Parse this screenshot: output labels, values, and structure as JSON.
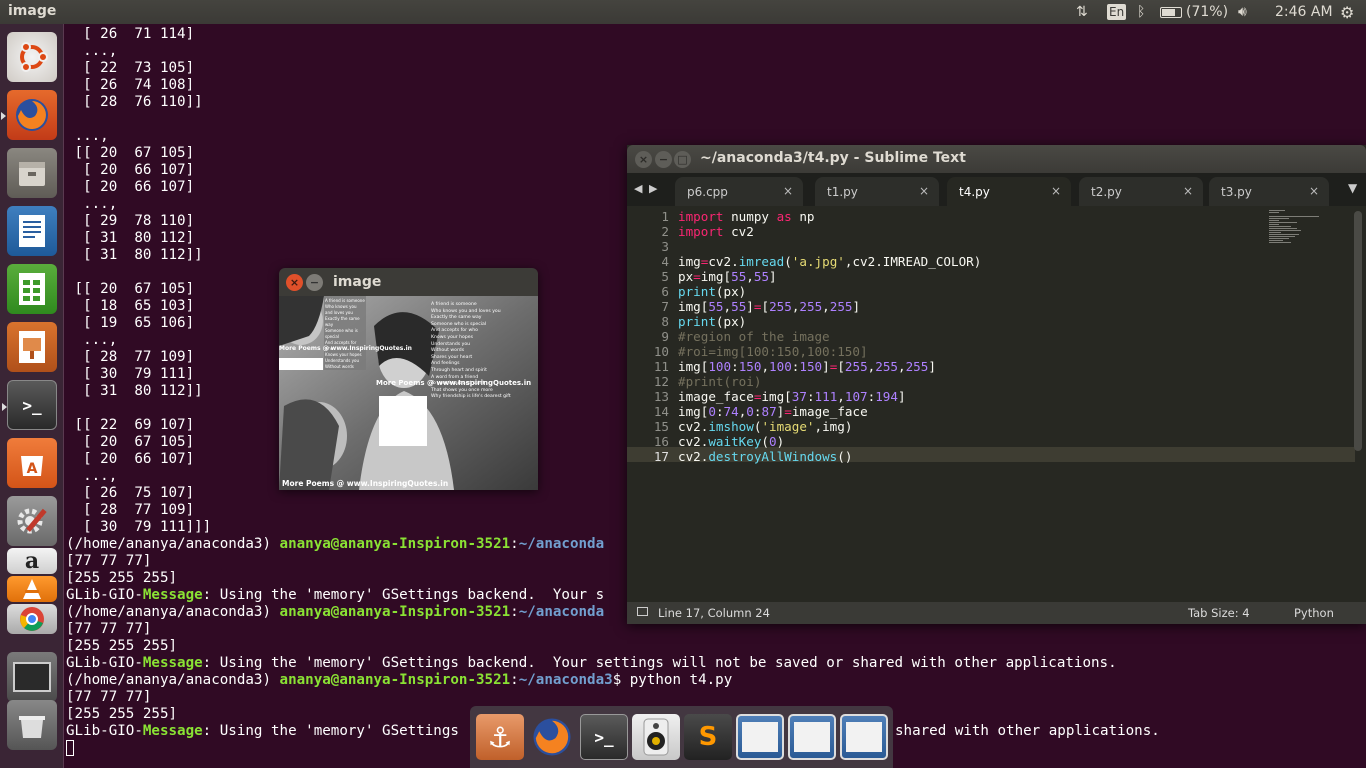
{
  "topbar": {
    "app_title": "image",
    "keyboard_layout": "En",
    "battery": "(71%)",
    "clock": "2:46 AM"
  },
  "launcher": {
    "items": [
      "dash-home",
      "firefox",
      "files",
      "writer",
      "calc",
      "impress",
      "terminal",
      "software-center",
      "system-settings",
      "amazon",
      "vlc",
      "chrome",
      "workspaces",
      "trash"
    ]
  },
  "terminal": {
    "lines": [
      "  [ 26  71 114]",
      "  ...,",
      "  [ 22  73 105]",
      "  [ 26  74 108]",
      "  [ 28  76 110]]",
      "",
      " ...,",
      " [[ 20  67 105]",
      "  [ 20  66 107]",
      "  [ 20  66 107]",
      "  ...,",
      "  [ 29  78 110]",
      "  [ 31  80 112]",
      "  [ 31  80 112]]",
      "",
      " [[ 20  67 105]",
      "  [ 18  65 103]",
      "  [ 19  65 106]",
      "  ...,",
      "  [ 28  77 109]",
      "  [ 30  79 111]",
      "  [ 31  80 112]]",
      "",
      " [[ 22  69 107]",
      "  [ 20  67 105]",
      "  [ 20  66 107]",
      "  ...,",
      "  [ 26  75 107]",
      "  [ 28  77 109]",
      "  [ 30  79 111]]]"
    ],
    "prompt_env": "(/home/ananya/anaconda3) ",
    "prompt_user": "ananya@ananya-Inspiron-3521",
    "prompt_colon": ":",
    "prompt_path_partial": "~/anaconda",
    "prompt_path": "~/anaconda3",
    "prompt_cmd": "$ python t4.py",
    "out1": "[77 77 77]",
    "out2": "[255 255 255]",
    "glib_prefix": "GLib-GIO-",
    "glib_msg": "Message",
    "glib_rest_partial": ": Using the 'memory' GSettings backend.  Your s",
    "glib_rest_full": ": Using the 'memory' GSettings backend.  Your settings will not be saved or shared with other applications.",
    "glib_rest_tail_a": ": Using the 'memory' GSettings",
    "glib_rest_tail_b": "shared with other applications."
  },
  "image_window": {
    "title": "image",
    "photo_captions": [
      "More Poems @ www.InspiringQuotes.in",
      "More Poems @ www.InspiringQuotes.in",
      "More Poems @ www.InspiringQuotes.in"
    ],
    "poem_lines": [
      "A friend is someone",
      "Who knows you and loves you",
      "Exactly the same way",
      "Someone who is special",
      "And accepts for who",
      "Knows your hopes",
      "Understands you",
      "Without words",
      "Shares your heart",
      "And feelings",
      "Through heart and spirit",
      "A word from a friend",
      "To your heart and spirit",
      "That shows you once more",
      "Why friendship is life's dearest gift"
    ]
  },
  "sublime": {
    "title": "~/anaconda3/t4.py - Sublime Text",
    "tabs": [
      {
        "label": "p6.cpp"
      },
      {
        "label": "t1.py"
      },
      {
        "label": "t4.py"
      },
      {
        "label": "t2.py"
      },
      {
        "label": "t3.py"
      }
    ],
    "tab_close": "×",
    "line_numbers": [
      "1",
      "2",
      "3",
      "4",
      "5",
      "6",
      "7",
      "8",
      "9",
      "10",
      "11",
      "12",
      "13",
      "14",
      "15",
      "16",
      "17"
    ],
    "status_position": "Line 17, Column 24",
    "status_tabsize": "Tab Size: 4",
    "status_syntax": "Python",
    "code": {
      "l1": [
        "import",
        " numpy ",
        "as",
        " np"
      ],
      "l2": [
        "import",
        " cv2"
      ],
      "l4": [
        "img",
        "=",
        "cv2.",
        "imread",
        "(",
        "'a.jpg'",
        ",cv2.IMREAD_COLOR)"
      ],
      "l5": [
        "px",
        "=",
        "img[",
        "55",
        ",",
        "55",
        "]"
      ],
      "l6": [
        "print",
        "(px)"
      ],
      "l7": [
        "img[",
        "55",
        ",",
        "55",
        "]",
        "=",
        "[",
        "255",
        ",",
        "255",
        ",",
        "255",
        "]"
      ],
      "l8": [
        "print",
        "(px)"
      ],
      "l9": "#region of the image",
      "l10": "#roi=img[100:150,100:150]",
      "l11": [
        "img[",
        "100",
        ":",
        "150",
        ",",
        "100",
        ":",
        "150",
        "]",
        "=",
        "[",
        "255",
        ",",
        "255",
        ",",
        "255",
        "]"
      ],
      "l12": "#print(roi)",
      "l13": [
        "image_face",
        "=",
        "img[",
        "37",
        ":",
        "111",
        ",",
        "107",
        ":",
        "194",
        "]"
      ],
      "l14": [
        "img[",
        "0",
        ":",
        "74",
        ",",
        "0",
        ":",
        "87",
        "]",
        "=",
        "image_face"
      ],
      "l15": [
        "cv2.",
        "imshow",
        "(",
        "'image'",
        ",img)"
      ],
      "l16": [
        "cv2.",
        "waitKey",
        "(",
        "0",
        ")"
      ],
      "l17": [
        "cv2.",
        "destroyAllWindows",
        "()"
      ]
    }
  },
  "switcher": {
    "items": [
      "anchor-app",
      "firefox",
      "terminal",
      "speaker-app",
      "sublime-text",
      "window-1",
      "window-2",
      "window-3"
    ]
  }
}
